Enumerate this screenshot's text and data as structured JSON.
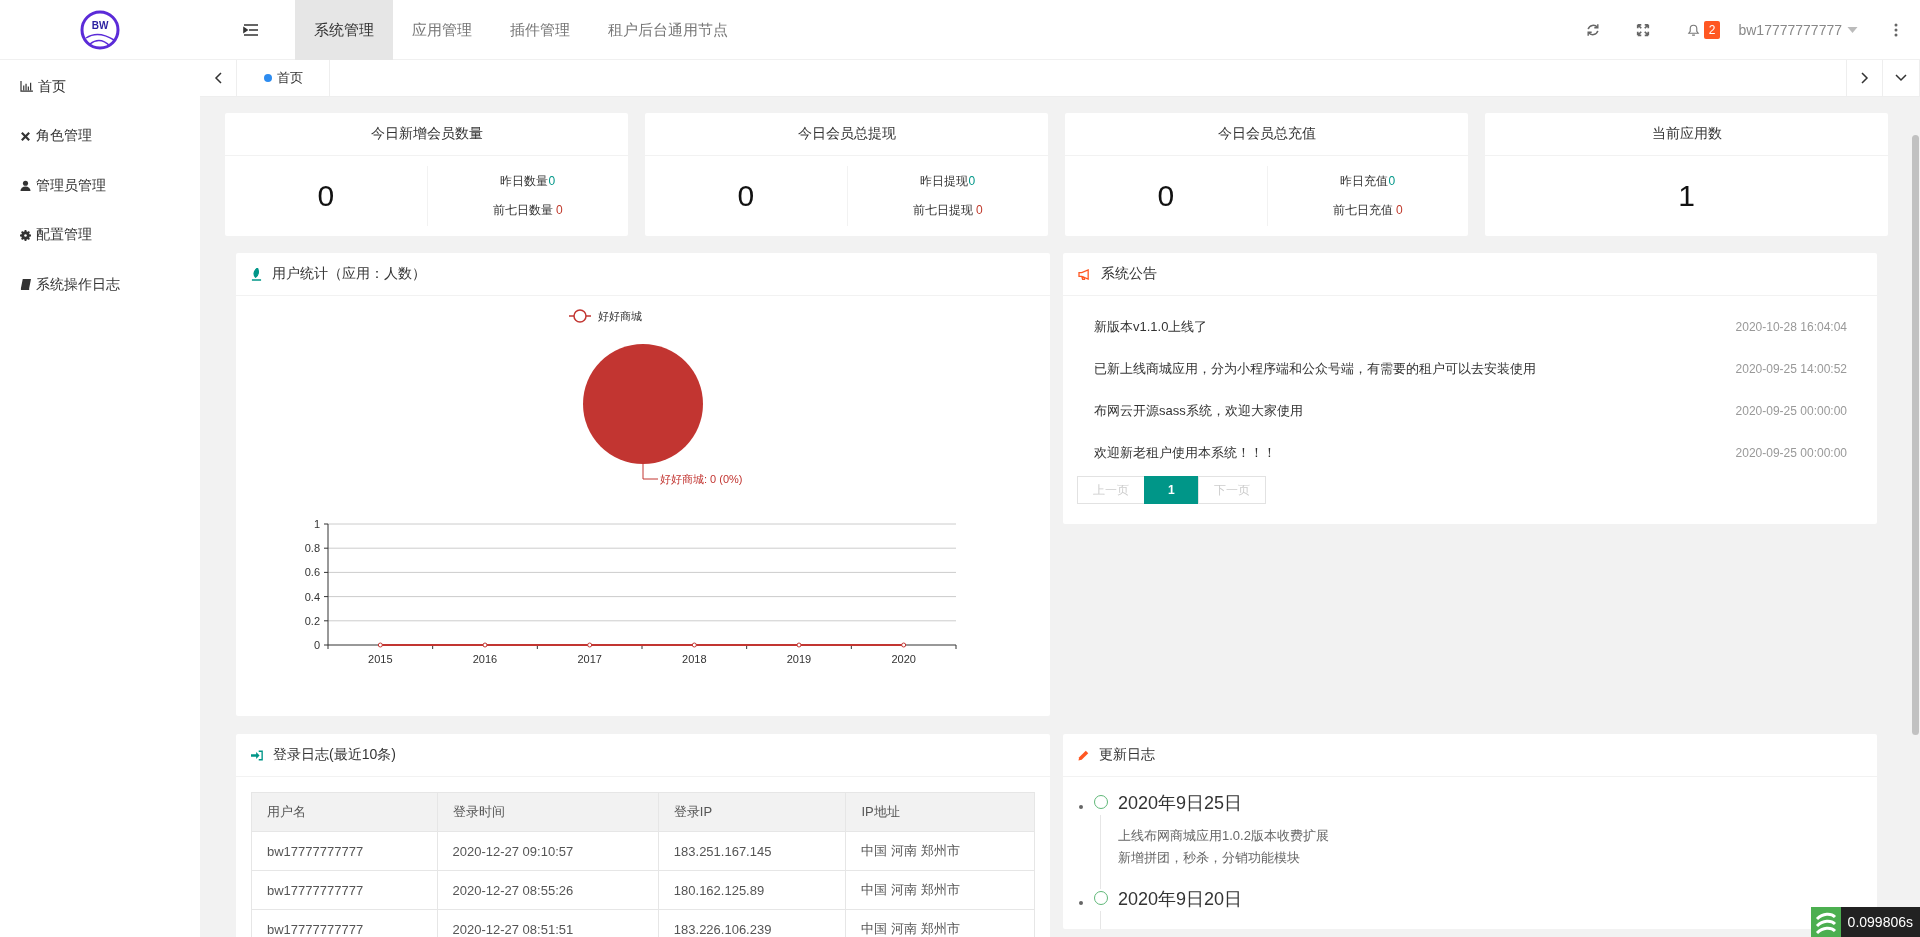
{
  "header": {
    "logo_text": "BW",
    "nav_tabs": [
      {
        "label": "系统管理",
        "selected": true
      },
      {
        "label": "应用管理",
        "selected": false
      },
      {
        "label": "插件管理",
        "selected": false
      },
      {
        "label": "租户后台通用节点",
        "selected": false
      }
    ],
    "notification_count": "2",
    "username": "bw17777777777"
  },
  "sidebar": {
    "items": [
      {
        "label": "首页"
      },
      {
        "label": "角色管理"
      },
      {
        "label": "管理员管理"
      },
      {
        "label": "配置管理"
      },
      {
        "label": "系统操作日志"
      }
    ]
  },
  "page_tabs": [
    {
      "label": "首页",
      "selected": true
    }
  ],
  "stats": [
    {
      "title": "今日新增会员数量",
      "value": "0",
      "details": [
        {
          "label": "昨日数量",
          "value": "0",
          "kind": "yesterday"
        },
        {
          "label": "前七日数量",
          "value": "0",
          "kind": "week"
        }
      ]
    },
    {
      "title": "今日会员总提现",
      "value": "0",
      "details": [
        {
          "label": "昨日提现",
          "value": "0",
          "kind": "yesterday"
        },
        {
          "label": "前七日提现",
          "value": "0",
          "kind": "week"
        }
      ]
    },
    {
      "title": "今日会员总充值",
      "value": "0",
      "details": [
        {
          "label": "昨日充值",
          "value": "0",
          "kind": "yesterday"
        },
        {
          "label": "前七日充值",
          "value": "0",
          "kind": "week"
        }
      ]
    },
    {
      "title": "当前应用数",
      "value": "1"
    }
  ],
  "user_stats": {
    "title": "用户统计（应用：人数）",
    "pie": {
      "legend": "好好商城",
      "label": "好好商城: 0 (0%)"
    },
    "line_chart": {
      "chart_data": {
        "type": "line",
        "x": [
          "2015",
          "2016",
          "2017",
          "2018",
          "2019",
          "2020"
        ],
        "values": [
          0,
          0,
          0,
          0,
          0,
          0
        ],
        "ylim": [
          0,
          1
        ],
        "yticks": [
          0,
          0.2,
          0.4,
          0.6,
          0.8,
          1
        ],
        "grid": true,
        "marker": true
      }
    }
  },
  "notices": {
    "title": "系统公告",
    "items": [
      {
        "text": "新版本v1.1.0上线了",
        "time": "2020-10-28 16:04:04"
      },
      {
        "text": "已新上线商城应用，分为小程序端和公众号端，有需要的租户可以去安装使用",
        "time": "2020-09-25 14:00:52"
      },
      {
        "text": "布网云开源sass系统，欢迎大家使用",
        "time": "2020-09-25 00:00:00"
      },
      {
        "text": "欢迎新老租户使用本系统！！！",
        "time": "2020-09-25 00:00:00"
      }
    ],
    "pagination": {
      "prev": {
        "label": "上一页",
        "disabled": true
      },
      "pages": [
        {
          "label": "1",
          "selected": true
        }
      ],
      "next": {
        "label": "下一页",
        "disabled": true
      }
    }
  },
  "login_log": {
    "title": "登录日志(最近10条)",
    "columns": [
      "用户名",
      "登录时间",
      "登录IP",
      "IP地址"
    ],
    "rows": [
      [
        "bw17777777777",
        "2020-12-27 09:10:57",
        "183.251.167.145",
        "中国 河南 郑州市"
      ],
      [
        "bw17777777777",
        "2020-12-27 08:55:26",
        "180.162.125.89",
        "中国 河南 郑州市"
      ],
      [
        "bw17777777777",
        "2020-12-27 08:51:51",
        "183.226.106.239",
        "中国 河南 郑州市"
      ]
    ]
  },
  "changelog": {
    "title": "更新日志",
    "entries": [
      {
        "date": "2020年9日25日",
        "lines": [
          "上线布网商城应用1.0.2版本收费扩展",
          "新增拼团，秒杀，分销功能模块"
        ]
      },
      {
        "date": "2020年9日20日"
      }
    ]
  },
  "trace_badge": "0.099806s"
}
